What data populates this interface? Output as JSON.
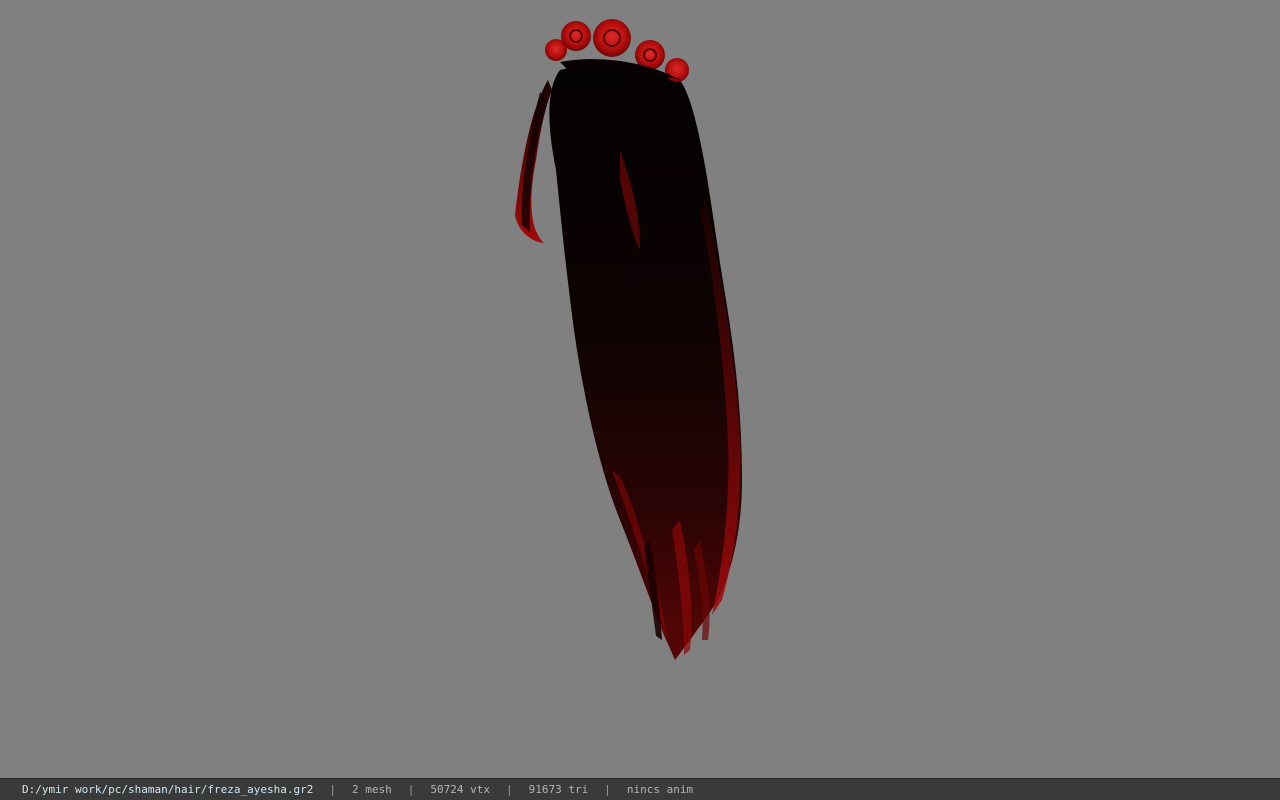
{
  "viewport": {
    "background_color": "#808080",
    "model_icon": "hair-model-icon",
    "model_colors": {
      "hair_dark": "#0a0303",
      "hair_red": "#7a0606",
      "rose": "#c21010",
      "rose_highlight": "#e02a2a"
    }
  },
  "statusbar": {
    "file_path": "D:/ymir work/pc/shaman/hair/freza_ayesha.gr2",
    "mesh_count": "2 mesh",
    "vertex_count": "50724 vtx",
    "triangle_count": "91673 tri",
    "anim_status": "nincs anim",
    "separator": "|",
    "background_color": "#3a3a3a",
    "path_color": "#cfe6f3"
  }
}
